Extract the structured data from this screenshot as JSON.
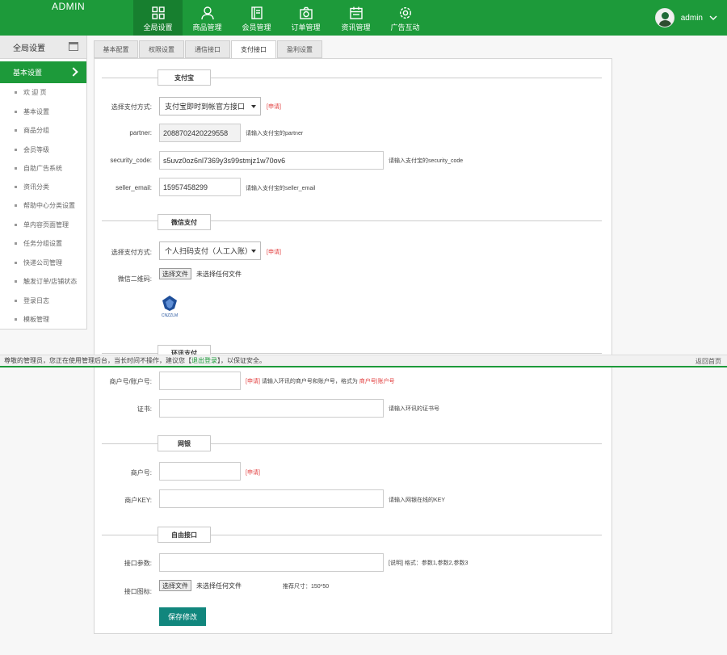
{
  "header": {
    "brand": "ADMIN",
    "nav": [
      {
        "label": "全局设置",
        "icon": "grid-icon"
      },
      {
        "label": "商品管理",
        "icon": "user-icon"
      },
      {
        "label": "会员管理",
        "icon": "book-icon"
      },
      {
        "label": "订单管理",
        "icon": "camera-icon"
      },
      {
        "label": "资讯管理",
        "icon": "calendar-icon"
      },
      {
        "label": "广告互动",
        "icon": "settings-icon"
      }
    ],
    "user_name": "admin"
  },
  "sidebar": {
    "title": "全局设置",
    "section": "基本设置",
    "items": [
      "欢 迎 页",
      "基本设置",
      "商品分组",
      "会员等级",
      "自助广告系统",
      "资讯分类",
      "帮助中心分类设置",
      "单内容页面管理",
      "任务分组设置",
      "快递公司管理",
      "触发订单/店铺状态",
      "登录日志",
      "模板管理"
    ]
  },
  "tabs": [
    "基本配置",
    "权限设置",
    "通信接口",
    "支付接口",
    "盈利设置"
  ],
  "alipay": {
    "legend": "支付宝",
    "method_label": "选择支付方式:",
    "method_value": "支付宝即时到帐官方接口",
    "apply": "[申请]",
    "partner_label": "partner:",
    "partner_value": "2088702420229558",
    "partner_hint": "请输入支付宝的partner",
    "code_label": "security_code:",
    "code_value": "s5uvz0oz6nl7369y3s99stmjz1w70ov6",
    "code_hint": "请输入支付宝的security_code",
    "email_label": "seller_email:",
    "email_value": "15957458299",
    "email_hint": "请输入支付宝的seller_email"
  },
  "wechat": {
    "legend": "微信支付",
    "method_label": "选择支付方式:",
    "method_value": "个人扫码支付（人工入账）",
    "apply": "[申请]",
    "qr_label": "微信二维码:",
    "file_btn": "选择文件",
    "file_none": "未选择任何文件",
    "logo_text": "CNZZLM"
  },
  "huanxun": {
    "legend": "环讯支付",
    "merchant_label": "商户号/账户号:",
    "merchant_apply": "[申请]",
    "merchant_hint": "请输入环讯的商户号和账户号，格式为",
    "merchant_format": "商户号|账户号",
    "cert_label": "证书:",
    "cert_hint": "请输入环讯的证书号"
  },
  "netbank": {
    "legend": "网银",
    "merchant_label": "商户号:",
    "apply": "[申请]",
    "key_label": "商户KEY:",
    "key_hint": "请输入网银在线的KEY"
  },
  "custom": {
    "legend": "自由接口",
    "params_label": "接口参数:",
    "params_hint": "[说明] 格式：参数1,参数2,参数3",
    "icon_label": "接口图标:",
    "file_btn": "选择文件",
    "file_none": "未选择任何文件",
    "size_hint": "推荐尺寸：150*50"
  },
  "save_label": "保存修改",
  "notice": {
    "text_before": "尊敬的管理员，您正在使用管理后台，当长时间不操作，建议您【",
    "exit": "退出登录",
    "text_after": "】，以保证安全。",
    "home": "返回首页"
  }
}
